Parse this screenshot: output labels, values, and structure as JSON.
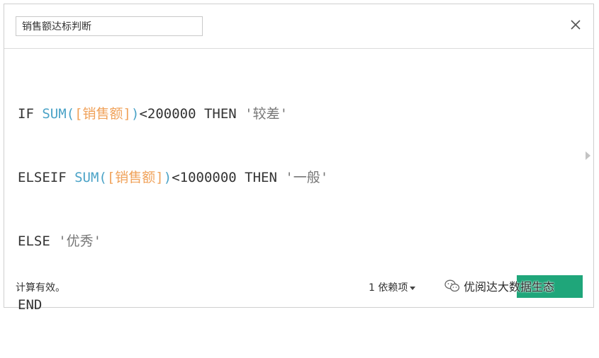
{
  "dialog": {
    "name_value": "销售额达标判断",
    "close_icon": "close-icon"
  },
  "formula": {
    "line1": {
      "kw1": "IF ",
      "fn": "SUM",
      "p1": "(",
      "field": "[销售额]",
      "p2": ")",
      "op": "<200000 ",
      "kw2": "THEN ",
      "str": "'较差'"
    },
    "line2": {
      "kw1": "ELSEIF ",
      "fn": "SUM",
      "p1": "(",
      "field": "[销售额]",
      "p2": ")",
      "op": "<1000000 ",
      "kw2": "THEN ",
      "str": "'一般'"
    },
    "line3": {
      "kw1": "ELSE ",
      "str": "'优秀'"
    },
    "line4": {
      "kw1": "END"
    }
  },
  "colors": {
    "function": "#4ba3c7",
    "field": "#f0a25a",
    "string": "#777777",
    "apply_button": "#1fa67a"
  },
  "footer": {
    "status": "计算有效。",
    "dependencies": "1 依赖项",
    "watermark": "优阅达大数据生态"
  }
}
